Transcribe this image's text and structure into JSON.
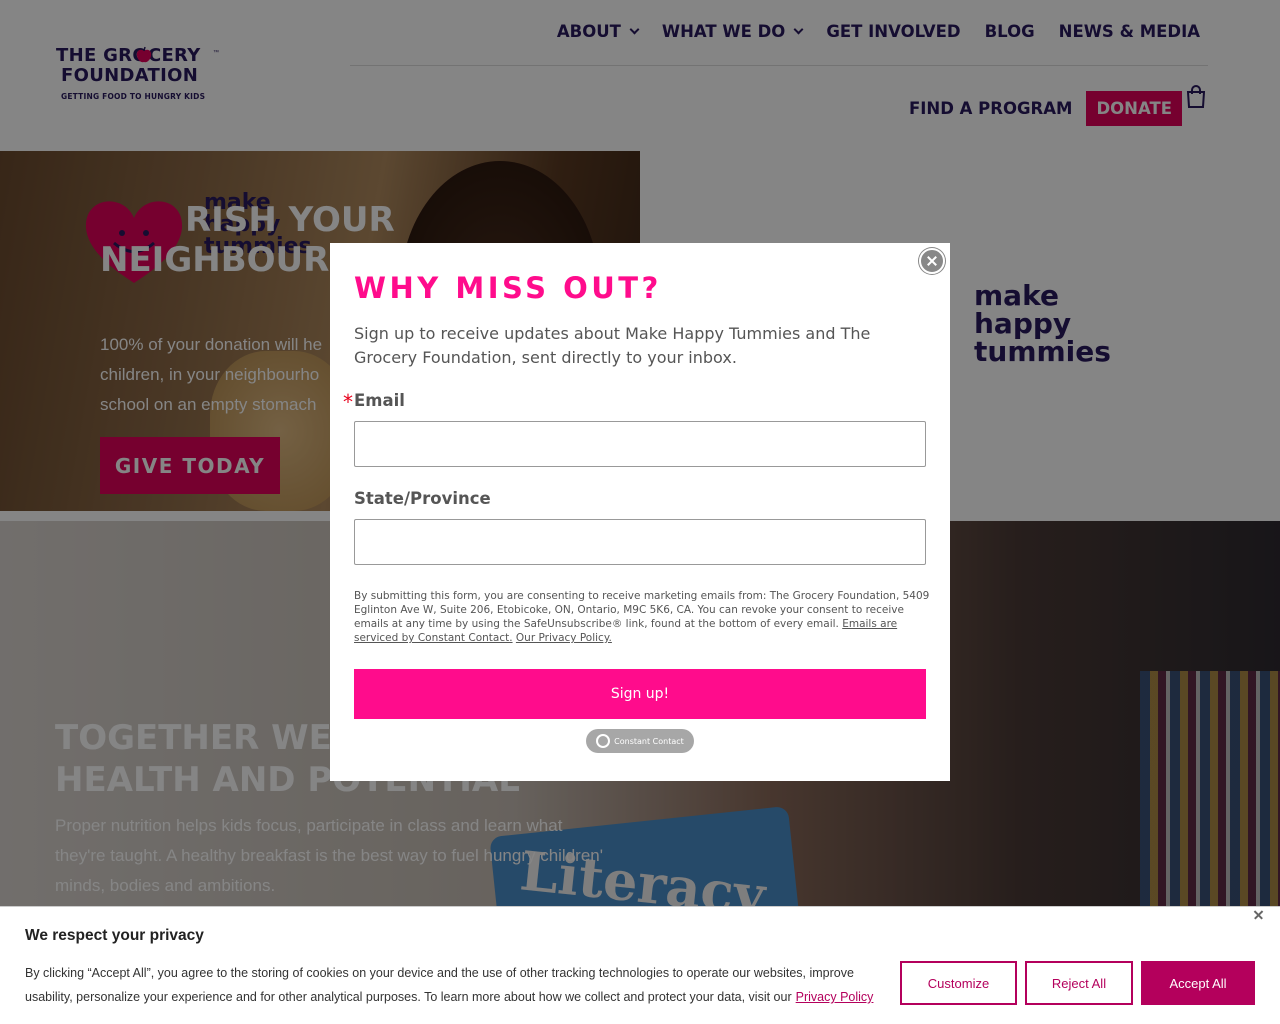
{
  "header": {
    "logo": {
      "line1": "THE GROCERY",
      "line2": "FOUNDATION",
      "tagline": "GETTING FOOD TO HUNGRY KIDS"
    },
    "nav_top": [
      {
        "label": "ABOUT",
        "has_dropdown": true
      },
      {
        "label": "WHAT WE DO",
        "has_dropdown": true
      },
      {
        "label": "GET INVOLVED",
        "has_dropdown": false
      },
      {
        "label": "BLOG",
        "has_dropdown": false
      },
      {
        "label": "NEWS & MEDIA",
        "has_dropdown": false
      }
    ],
    "find_program": "FIND A PROGRAM",
    "donate": "DONATE",
    "cart_icon": "shopping-bag-icon"
  },
  "hero": {
    "logo_words": [
      "make",
      "happy",
      "tummies"
    ],
    "title_line1": "RISH YOUR",
    "title_line2": "NEIGHBOURH",
    "text_line1": "100% of your donation will he",
    "text_line2": "children, in your neighbourho",
    "text_line3": "school on an empty stomach",
    "give_button": "GIVE TODAY"
  },
  "right_logo": {
    "words": [
      "make",
      "happy",
      "tummies"
    ]
  },
  "lower": {
    "title_line1": "TOGETHER WE C",
    "title_line2": "HEALTH AND POTENTIAL",
    "text": "Proper nutrition helps kids focus, participate in class and learn what they're taught. A healthy breakfast is the best way to fuel hungry children' minds, bodies and ambitions.",
    "book_word": "Literacy"
  },
  "modal": {
    "title": "WHY MISS OUT?",
    "description": "Sign up to receive updates about Make Happy Tummies and The Grocery Foundation, sent directly to your inbox.",
    "required_mark": "*",
    "email_label": "Email",
    "email_value": "",
    "state_label": "State/Province",
    "state_value": "",
    "legal_text": "By submitting this form, you are consenting to receive marketing emails from: The Grocery Foundation, 5409 Eglinton Ave W, Suite 206, Etobicoke, ON, Ontario, M9C 5K6, CA. You can revoke your consent to receive emails at any time by using the SafeUnsubscribe® link, found at the bottom of every email.",
    "legal_link1": "Emails are serviced by Constant Contact.",
    "legal_link2": "Our Privacy Policy.",
    "signup_button": "Sign up!",
    "badge_text": "Constant Contact"
  },
  "cookie": {
    "title": "We respect your privacy",
    "text": "By clicking “Accept All”, you agree to the storing of cookies on your device and the use of other tracking technologies to operate our websites, improve usability, personalize your experience and for other analytical purposes. To learn more about how we collect and protect your data, visit our",
    "privacy_link": "Privacy Policy",
    "customize": "Customize",
    "reject": "Reject All",
    "accept": "Accept All"
  },
  "colors": {
    "brand_navy": "#2a1a5e",
    "brand_pink": "#e2005a",
    "modal_pink": "#ff0c8c",
    "cookie_magenta": "#b4005c"
  }
}
